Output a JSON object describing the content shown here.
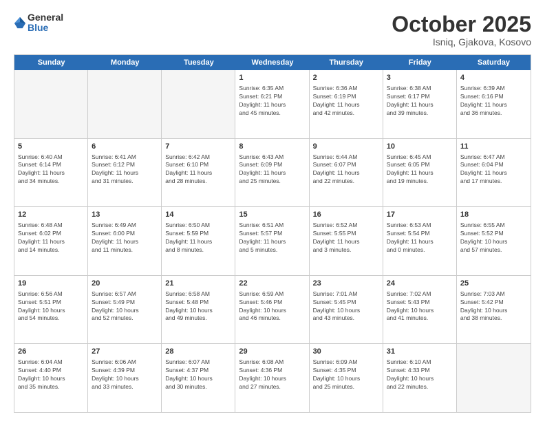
{
  "logo": {
    "general": "General",
    "blue": "Blue",
    "tagline": ""
  },
  "title": "October 2025",
  "location": "Isniq, Gjakova, Kosovo",
  "days_of_week": [
    "Sunday",
    "Monday",
    "Tuesday",
    "Wednesday",
    "Thursday",
    "Friday",
    "Saturday"
  ],
  "weeks": [
    [
      {
        "day": "",
        "info": ""
      },
      {
        "day": "",
        "info": ""
      },
      {
        "day": "",
        "info": ""
      },
      {
        "day": "1",
        "info": "Sunrise: 6:35 AM\nSunset: 6:21 PM\nDaylight: 11 hours\nand 45 minutes."
      },
      {
        "day": "2",
        "info": "Sunrise: 6:36 AM\nSunset: 6:19 PM\nDaylight: 11 hours\nand 42 minutes."
      },
      {
        "day": "3",
        "info": "Sunrise: 6:38 AM\nSunset: 6:17 PM\nDaylight: 11 hours\nand 39 minutes."
      },
      {
        "day": "4",
        "info": "Sunrise: 6:39 AM\nSunset: 6:16 PM\nDaylight: 11 hours\nand 36 minutes."
      }
    ],
    [
      {
        "day": "5",
        "info": "Sunrise: 6:40 AM\nSunset: 6:14 PM\nDaylight: 11 hours\nand 34 minutes."
      },
      {
        "day": "6",
        "info": "Sunrise: 6:41 AM\nSunset: 6:12 PM\nDaylight: 11 hours\nand 31 minutes."
      },
      {
        "day": "7",
        "info": "Sunrise: 6:42 AM\nSunset: 6:10 PM\nDaylight: 11 hours\nand 28 minutes."
      },
      {
        "day": "8",
        "info": "Sunrise: 6:43 AM\nSunset: 6:09 PM\nDaylight: 11 hours\nand 25 minutes."
      },
      {
        "day": "9",
        "info": "Sunrise: 6:44 AM\nSunset: 6:07 PM\nDaylight: 11 hours\nand 22 minutes."
      },
      {
        "day": "10",
        "info": "Sunrise: 6:45 AM\nSunset: 6:05 PM\nDaylight: 11 hours\nand 19 minutes."
      },
      {
        "day": "11",
        "info": "Sunrise: 6:47 AM\nSunset: 6:04 PM\nDaylight: 11 hours\nand 17 minutes."
      }
    ],
    [
      {
        "day": "12",
        "info": "Sunrise: 6:48 AM\nSunset: 6:02 PM\nDaylight: 11 hours\nand 14 minutes."
      },
      {
        "day": "13",
        "info": "Sunrise: 6:49 AM\nSunset: 6:00 PM\nDaylight: 11 hours\nand 11 minutes."
      },
      {
        "day": "14",
        "info": "Sunrise: 6:50 AM\nSunset: 5:59 PM\nDaylight: 11 hours\nand 8 minutes."
      },
      {
        "day": "15",
        "info": "Sunrise: 6:51 AM\nSunset: 5:57 PM\nDaylight: 11 hours\nand 5 minutes."
      },
      {
        "day": "16",
        "info": "Sunrise: 6:52 AM\nSunset: 5:55 PM\nDaylight: 11 hours\nand 3 minutes."
      },
      {
        "day": "17",
        "info": "Sunrise: 6:53 AM\nSunset: 5:54 PM\nDaylight: 11 hours\nand 0 minutes."
      },
      {
        "day": "18",
        "info": "Sunrise: 6:55 AM\nSunset: 5:52 PM\nDaylight: 10 hours\nand 57 minutes."
      }
    ],
    [
      {
        "day": "19",
        "info": "Sunrise: 6:56 AM\nSunset: 5:51 PM\nDaylight: 10 hours\nand 54 minutes."
      },
      {
        "day": "20",
        "info": "Sunrise: 6:57 AM\nSunset: 5:49 PM\nDaylight: 10 hours\nand 52 minutes."
      },
      {
        "day": "21",
        "info": "Sunrise: 6:58 AM\nSunset: 5:48 PM\nDaylight: 10 hours\nand 49 minutes."
      },
      {
        "day": "22",
        "info": "Sunrise: 6:59 AM\nSunset: 5:46 PM\nDaylight: 10 hours\nand 46 minutes."
      },
      {
        "day": "23",
        "info": "Sunrise: 7:01 AM\nSunset: 5:45 PM\nDaylight: 10 hours\nand 43 minutes."
      },
      {
        "day": "24",
        "info": "Sunrise: 7:02 AM\nSunset: 5:43 PM\nDaylight: 10 hours\nand 41 minutes."
      },
      {
        "day": "25",
        "info": "Sunrise: 7:03 AM\nSunset: 5:42 PM\nDaylight: 10 hours\nand 38 minutes."
      }
    ],
    [
      {
        "day": "26",
        "info": "Sunrise: 6:04 AM\nSunset: 4:40 PM\nDaylight: 10 hours\nand 35 minutes."
      },
      {
        "day": "27",
        "info": "Sunrise: 6:06 AM\nSunset: 4:39 PM\nDaylight: 10 hours\nand 33 minutes."
      },
      {
        "day": "28",
        "info": "Sunrise: 6:07 AM\nSunset: 4:37 PM\nDaylight: 10 hours\nand 30 minutes."
      },
      {
        "day": "29",
        "info": "Sunrise: 6:08 AM\nSunset: 4:36 PM\nDaylight: 10 hours\nand 27 minutes."
      },
      {
        "day": "30",
        "info": "Sunrise: 6:09 AM\nSunset: 4:35 PM\nDaylight: 10 hours\nand 25 minutes."
      },
      {
        "day": "31",
        "info": "Sunrise: 6:10 AM\nSunset: 4:33 PM\nDaylight: 10 hours\nand 22 minutes."
      },
      {
        "day": "",
        "info": ""
      }
    ]
  ]
}
